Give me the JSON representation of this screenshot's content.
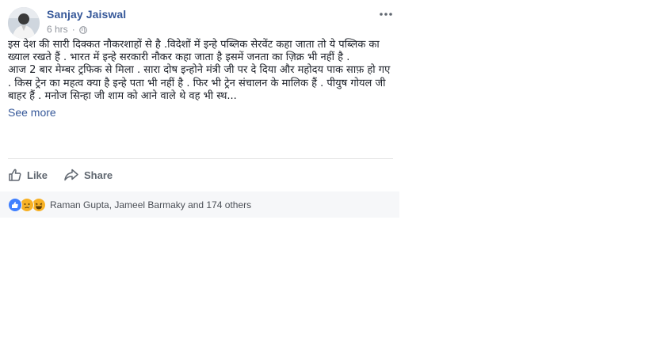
{
  "post": {
    "author": "Sanjay Jaiswal",
    "time": "6 hrs",
    "separator": "·",
    "privacy_icon": "globe-icon",
    "menu_icon": "more-options-icon",
    "paragraphs": [
      "इस देश की सारी दिक्कत नौकरशाहों से है .विदेशों में इन्हे पब्लिक सेरवेंट कहा जाता तो ये पब्लिक का ख्याल रखते हैं . भारत में इन्हे सरकारी नौकर कहा जाता है इसमें जनता का ज़िक्र भी नहीं है .",
      "आज 2 बार मेम्बर ट्रफिक से मिला . सारा दोष इन्होने मंत्री जी पर दे दिया और महोदय पाक साफ़ हो गए . किस ट्रेन का महत्व क्या है इन्हे पता भी नहीं है . फिर भी ट्रेन संचालन के मालिक हैं . पीयुष गोयल जी बाहर हैं . मनोज सिन्हा जी शाम को आने वाले थे वह भी स्थ..."
    ],
    "see_more": "See more"
  },
  "actions": {
    "like_label": "Like",
    "share_label": "Share"
  },
  "reactions": {
    "icons": [
      "like-reaction-icon",
      "sad-reaction-icon",
      "haha-reaction-icon"
    ],
    "summary": "Raman Gupta, Jameel Barmaky and 174 others"
  },
  "colors": {
    "link_blue": "#365899",
    "meta_gray": "#90949c",
    "text": "#1d2129",
    "like_blue": "#4080ff",
    "reaction_yellow": "#f7b125"
  }
}
